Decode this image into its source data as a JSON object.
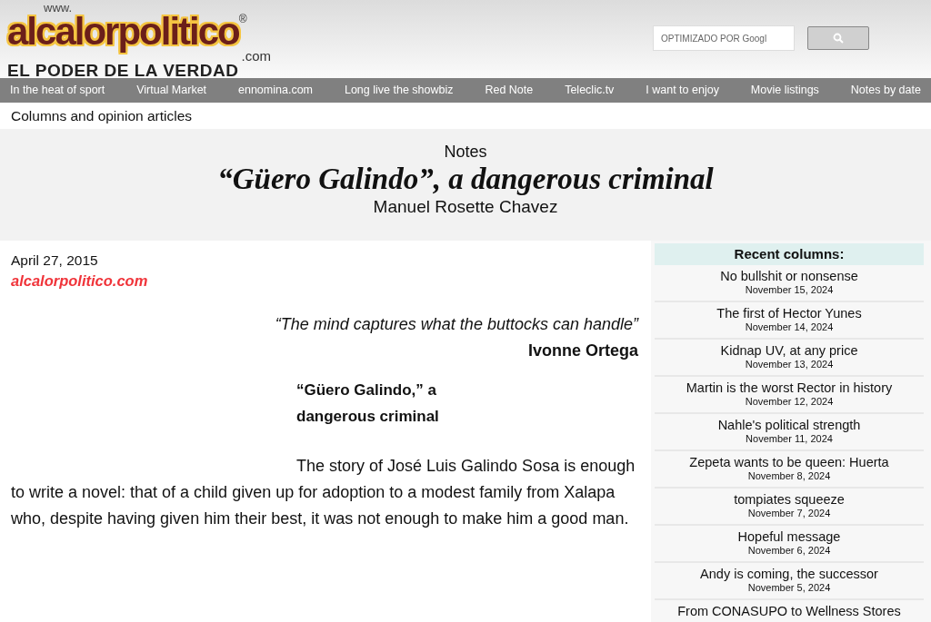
{
  "logo": {
    "prefix": "www.",
    "name": "alcalorpolitico",
    "mark": "®",
    "suffix": ".com",
    "tagline": "EL PODER DE LA VERDAD"
  },
  "search": {
    "placeholder": "OPTIMIZADO POR Googl"
  },
  "nav": [
    "In the heat of sport",
    "Virtual Market",
    "ennomina.com",
    "Long live the showbiz",
    "Red Note",
    "Teleclic.tv",
    "I want to enjoy",
    "Movie listings",
    "Notes by date"
  ],
  "breadcrumb": "Columns and opinion articles",
  "article": {
    "section": "Notes",
    "title": "“Güero Galindo”, a dangerous criminal",
    "author": "Manuel Rosette Chavez",
    "date": "April 27, 2015",
    "source": "alcalorpolitico.com",
    "quote": "“The mind captures what the buttocks can handle”",
    "quote_author": "Ivonne Ortega",
    "subtitle_lines": [
      "“Güero Galindo,” a",
      "dangerous criminal"
    ],
    "body": "The story of José Luis Galindo Sosa is enough to write a novel: that of a child given up for adoption to a modest family from Xalapa who, despite having given him their best, it was not enough to make him a good man."
  },
  "sidebar": {
    "title": "Recent columns:",
    "items": [
      {
        "title": "No bullshit or nonsense",
        "date": "November 15, 2024"
      },
      {
        "title": "The first of Hector Yunes",
        "date": "November 14, 2024"
      },
      {
        "title": "Kidnap UV, at any price",
        "date": "November 13, 2024"
      },
      {
        "title": "Martin is the worst Rector in history",
        "date": "November 12, 2024"
      },
      {
        "title": "Nahle's political strength",
        "date": "November 11, 2024"
      },
      {
        "title": "Zepeta wants to be queen: Huerta",
        "date": "November 8, 2024"
      },
      {
        "title": "tompiates squeeze",
        "date": "November 7, 2024"
      },
      {
        "title": "Hopeful message",
        "date": "November 6, 2024"
      },
      {
        "title": "Andy is coming, the successor",
        "date": "November 5, 2024"
      },
      {
        "title": "From CONASUPO to Wellness Stores"
      }
    ]
  }
}
